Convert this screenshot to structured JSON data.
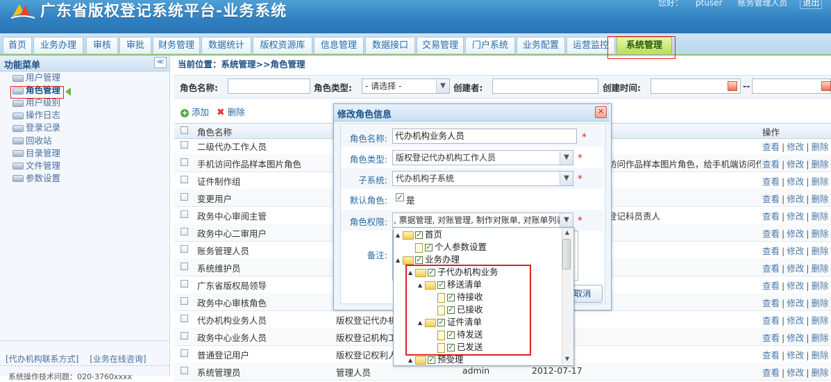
{
  "header": {
    "title": "广东省版权登记系统平台-业务系统",
    "welcome_label": "您好：",
    "username": "ptuser",
    "role": "账务管理人员",
    "logout": "退出"
  },
  "tabs": [
    {
      "label": "首页"
    },
    {
      "label": "业务办理"
    },
    {
      "label": "审核"
    },
    {
      "label": "审批"
    },
    {
      "label": "财务管理"
    },
    {
      "label": "数据统计"
    },
    {
      "label": "版权资源库"
    },
    {
      "label": "信息管理"
    },
    {
      "label": "数据接口"
    },
    {
      "label": "交易管理"
    },
    {
      "label": "门户系统"
    },
    {
      "label": "业务配置"
    },
    {
      "label": "运营监控"
    },
    {
      "label": "系统管理"
    }
  ],
  "sidebar": {
    "title": "功能菜单",
    "collapse": "≪",
    "items": [
      {
        "label": "用户管理"
      },
      {
        "label": "角色管理"
      },
      {
        "label": "用户级别"
      },
      {
        "label": "操作日志"
      },
      {
        "label": "登录记录"
      },
      {
        "label": "回收站"
      },
      {
        "label": "目录管理"
      },
      {
        "label": "文件管理"
      },
      {
        "label": "参数设置"
      }
    ],
    "link_contact": "[代办机构联系方式]",
    "link_consult": "[业务在线咨询]",
    "footer": "系统操作技术问题：020-3760xxxx"
  },
  "main": {
    "breadcrumb": "当前位置：系统管理>>角色管理",
    "search": {
      "name_label": "角色名称:",
      "type_label": "角色类型:",
      "type_value": "- 请选择 -",
      "creator_label": "创建者:",
      "created_label": "创建时间:",
      "range_sep": "--"
    },
    "actions": {
      "add": "添加",
      "delete": "删除"
    },
    "grid": {
      "col_name": "角色名称",
      "col_ops": "操作",
      "op_view": "查看",
      "op_edit": "修改",
      "op_delete": "删除",
      "rows": [
        {
          "name": "二级代办工作人员",
          "type": "",
          "desc": ""
        },
        {
          "name": "手机访问作品样本图片角色",
          "type": "",
          "desc": "访问作品样本图片角色，给手机端访问作品"
        },
        {
          "name": "证件制作组",
          "type": "",
          "desc": ""
        },
        {
          "name": "变更用户",
          "type": "",
          "desc": ""
        },
        {
          "name": "政务中心审阅主管",
          "type": "",
          "desc": "登记科员责人"
        },
        {
          "name": "政务中心二审用户",
          "type": "",
          "desc": ""
        },
        {
          "name": "账务管理人员",
          "type": "",
          "desc": ""
        },
        {
          "name": "系统维护员",
          "type": "",
          "desc": ""
        },
        {
          "name": "广东省版权局领导",
          "type": "",
          "desc": ""
        },
        {
          "name": "政务中心审核角色",
          "type": "",
          "desc": ""
        },
        {
          "name": "代办机构业务人员",
          "type": "版权登记代办机",
          "desc": ""
        },
        {
          "name": "政务中心业务人员",
          "type": "版权登记机构工",
          "desc": ""
        },
        {
          "name": "普通登记用户",
          "type": "版权登记权利人",
          "desc": ""
        },
        {
          "name": "系统管理员",
          "type": "管理人员",
          "creator": "admin",
          "date": "2012-07-17",
          "desc": ""
        }
      ]
    }
  },
  "dialog": {
    "title": "修改角色信息",
    "close": "✕",
    "name_label": "角色名称:",
    "name_value": "代办机构业务人员",
    "type_label": "角色类型:",
    "type_value": "版权登记代办机构工作人员",
    "subsystem_label": "子系统:",
    "subsystem_value": "代办机构子系统",
    "default_label": "默认角色:",
    "default_text": "是",
    "perm_label": "角色权限:",
    "perm_value": ", 票据管理, 对账管理, 制作对账单, 对账单列表",
    "remark_label": "备注:",
    "cancel": "取消",
    "required_mark": "*"
  },
  "tree": {
    "nodes": [
      {
        "label": "首页"
      },
      {
        "label": "个人参数设置"
      },
      {
        "label": "业务办理"
      },
      {
        "label": "子代办机构业务"
      },
      {
        "label": "移送清单"
      },
      {
        "label": "待接收"
      },
      {
        "label": "已接收"
      },
      {
        "label": "证件清单"
      },
      {
        "label": "待发送"
      },
      {
        "label": "已发送"
      },
      {
        "label": "预受理"
      }
    ]
  },
  "colors": {
    "accent": "#2f7fc0",
    "active_tab": "#b8df5a",
    "highlight": "#e02020"
  }
}
